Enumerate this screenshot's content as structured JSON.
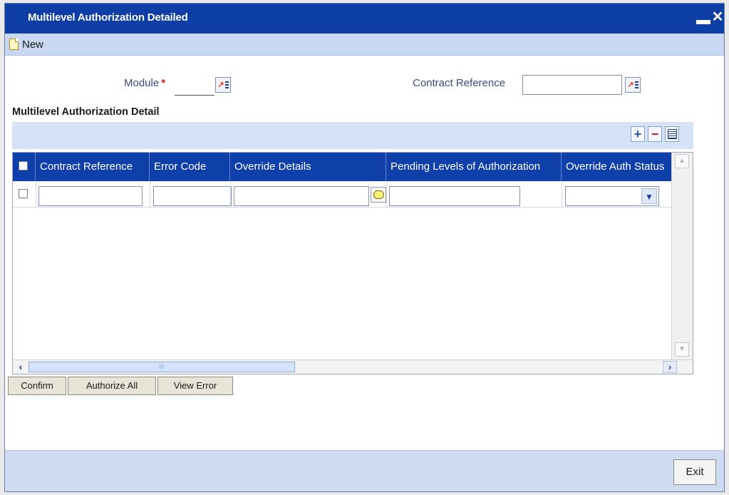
{
  "window": {
    "title": "Multilevel Authorization Detailed",
    "minimize_glyph": "▬",
    "close_glyph": "✕"
  },
  "toolbar": {
    "new_label": "New",
    "new_icon": "new-document-icon"
  },
  "form": {
    "module_label": "Module",
    "module_required_marker": "*",
    "module_value": "",
    "contract_reference_label": "Contract Reference",
    "contract_reference_value": "",
    "lov_icon": "list-of-values-icon"
  },
  "section": {
    "title": "Multilevel Authorization Detail"
  },
  "grid": {
    "toolbar_buttons": [
      {
        "label": "+",
        "icon": "add-row-icon"
      },
      {
        "label": "−",
        "icon": "delete-row-icon"
      },
      {
        "label": "",
        "icon": "single-record-view-icon"
      }
    ],
    "columns": [
      "Contract Reference",
      "Error Code",
      "Override Details",
      "Pending Levels of Authorization",
      "Override Auth Status"
    ],
    "rows": [
      {
        "checked": false,
        "contract_reference": "",
        "error_code": "",
        "override_details": "",
        "pending_levels": "",
        "override_auth_status": ""
      }
    ],
    "scroll_thumb_glyph": "III"
  },
  "actions": {
    "confirm_label": "Confirm",
    "authorize_all_label": "Authorize All",
    "view_error_label": "View Error"
  },
  "footer": {
    "exit_label": "Exit"
  },
  "colors": {
    "title_bar": "#0d3ea6",
    "toolbar": "#c9d8f2",
    "grid_header": "#0f40aa",
    "required": "#d0161b",
    "footer": "#cfdbf1"
  }
}
